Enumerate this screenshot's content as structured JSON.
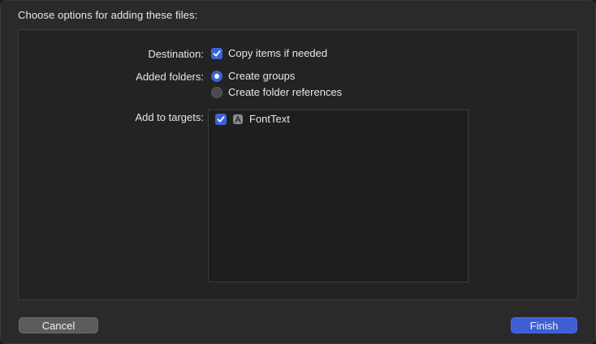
{
  "dialog": {
    "title": "Choose options for adding these files:"
  },
  "options": {
    "destination": {
      "label": "Destination:",
      "checkbox_label": "Copy items if needed",
      "checked": true
    },
    "added_folders": {
      "label": "Added folders:",
      "choices": [
        {
          "label": "Create groups",
          "selected": true
        },
        {
          "label": "Create folder references",
          "selected": false
        }
      ]
    },
    "targets": {
      "label": "Add to targets:",
      "items": [
        {
          "label": "FontText",
          "checked": true,
          "icon": "app-target-icon"
        }
      ]
    }
  },
  "buttons": {
    "cancel": "Cancel",
    "finish": "Finish"
  },
  "colors": {
    "accent": "#3b63d6",
    "background": "#2a2a2a",
    "panel": "#232323"
  }
}
